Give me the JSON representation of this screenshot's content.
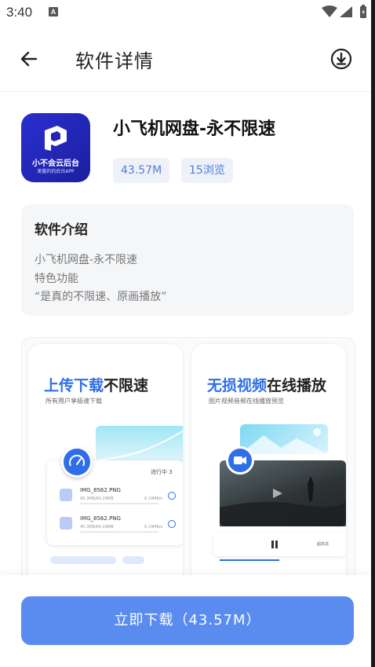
{
  "status_bar": {
    "time": "3:40",
    "notif_letter": "A"
  },
  "header": {
    "title": "软件详情"
  },
  "app": {
    "name": "小飞机网盘-永不限速",
    "size": "43.57M",
    "views": "15浏览",
    "icon_line1": "小不会云后台",
    "icon_line2": "美盤的的后台APP"
  },
  "intro": {
    "heading": "软件介绍",
    "lines": [
      "小飞机网盘-永不限速",
      "特色功能",
      "“是真的不限速、原画播放”"
    ]
  },
  "screenshots": [
    {
      "title_blue": "上传下载",
      "title_dark": "不限速",
      "subtitle": "所有用户享极速下载",
      "status": "进行中 3",
      "files": [
        {
          "name": "IMG_8562.PNG",
          "size": "40.3MB/64.29MB",
          "speed": "6.19MB/s"
        },
        {
          "name": "IMG_8562.PNG",
          "size": "40.3MB/64.29MB",
          "speed": "6.19MB/s"
        }
      ]
    },
    {
      "title_blue": "无损视频",
      "title_dark": "在线播放",
      "subtitle": "图片视频音频在线播放预览",
      "control_label": "超高清"
    }
  ],
  "download_button": {
    "label": "立即下载（43.57M）"
  },
  "colors": {
    "accent": "#5a8cf0",
    "tag_text": "#4d7fd9",
    "tag_bg": "#eef1f8",
    "icon_bg": "#2a2fd0"
  }
}
